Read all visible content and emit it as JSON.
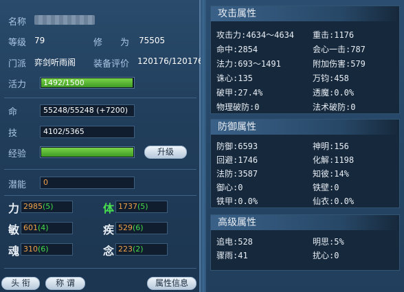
{
  "left": {
    "name_label": "名称",
    "level_label": "等级",
    "level_value": "79",
    "cultivation_label": "修　　为",
    "cultivation_value": "75505",
    "faction_label": "门派",
    "faction_value": "弈剑听雨阁",
    "equip_label": "装备评价",
    "equip_value": "120176/120176",
    "vitality_label": "活力",
    "vitality_text": "1492/1500",
    "vitality_fraction": 0.995,
    "life_label": "命",
    "life_value": "55248/55248 (+7200)",
    "skill_label": "技",
    "skill_value": "4102/5365",
    "exp_label": "经验",
    "exp_fraction": 1.0,
    "levelup_button": "升级",
    "potential_label": "潜能",
    "potential_value": "0",
    "stats": [
      {
        "name": "力",
        "value": "2985",
        "bonus": "(5)",
        "green": false
      },
      {
        "name": "体",
        "value": "1737",
        "bonus": "(5)",
        "green": true
      },
      {
        "name": "敏",
        "value": "601",
        "bonus": "(4)",
        "green": false
      },
      {
        "name": "疾",
        "value": "529",
        "bonus": "(6)",
        "green": false
      },
      {
        "name": "魂",
        "value": "310",
        "bonus": "(6)",
        "green": false
      },
      {
        "name": "念",
        "value": "223",
        "bonus": "(2)",
        "green": false
      }
    ],
    "buttons": {
      "title": "头 衔",
      "nickname": "称 谓",
      "attr_info": "属性信息"
    }
  },
  "right": {
    "attack_title": "攻击属性",
    "attack_rows": [
      [
        "攻击力:4634～4634",
        "重击:1176"
      ],
      [
        "命中:2854",
        "会心一击:787"
      ],
      [
        "法力:693～1491",
        "附加伤害:579"
      ],
      [
        "诛心:135",
        "万钧:458"
      ],
      [
        "破甲:27.4%",
        "透魔:0.0%"
      ],
      [
        "物理破防:0",
        "法术破防:0"
      ]
    ],
    "defense_title": "防御属性",
    "defense_rows": [
      [
        "防御:6593",
        "神明:156"
      ],
      [
        "回避:1746",
        "化解:1198"
      ],
      [
        "法防:3587",
        "知彼:14%"
      ],
      [
        "御心:0",
        "铁壁:0"
      ],
      [
        "铁甲:0.0%",
        "仙衣:0.0%"
      ]
    ],
    "advanced_title": "高级属性",
    "advanced_rows": [
      [
        "追电:528",
        "明思:5%"
      ],
      [
        "骤雨:41",
        "扰心:0"
      ]
    ]
  },
  "colors": {
    "bar_green": "#5cbf35",
    "stat_orange": "#f0a24a",
    "bonus_green": "#46dd4c"
  }
}
